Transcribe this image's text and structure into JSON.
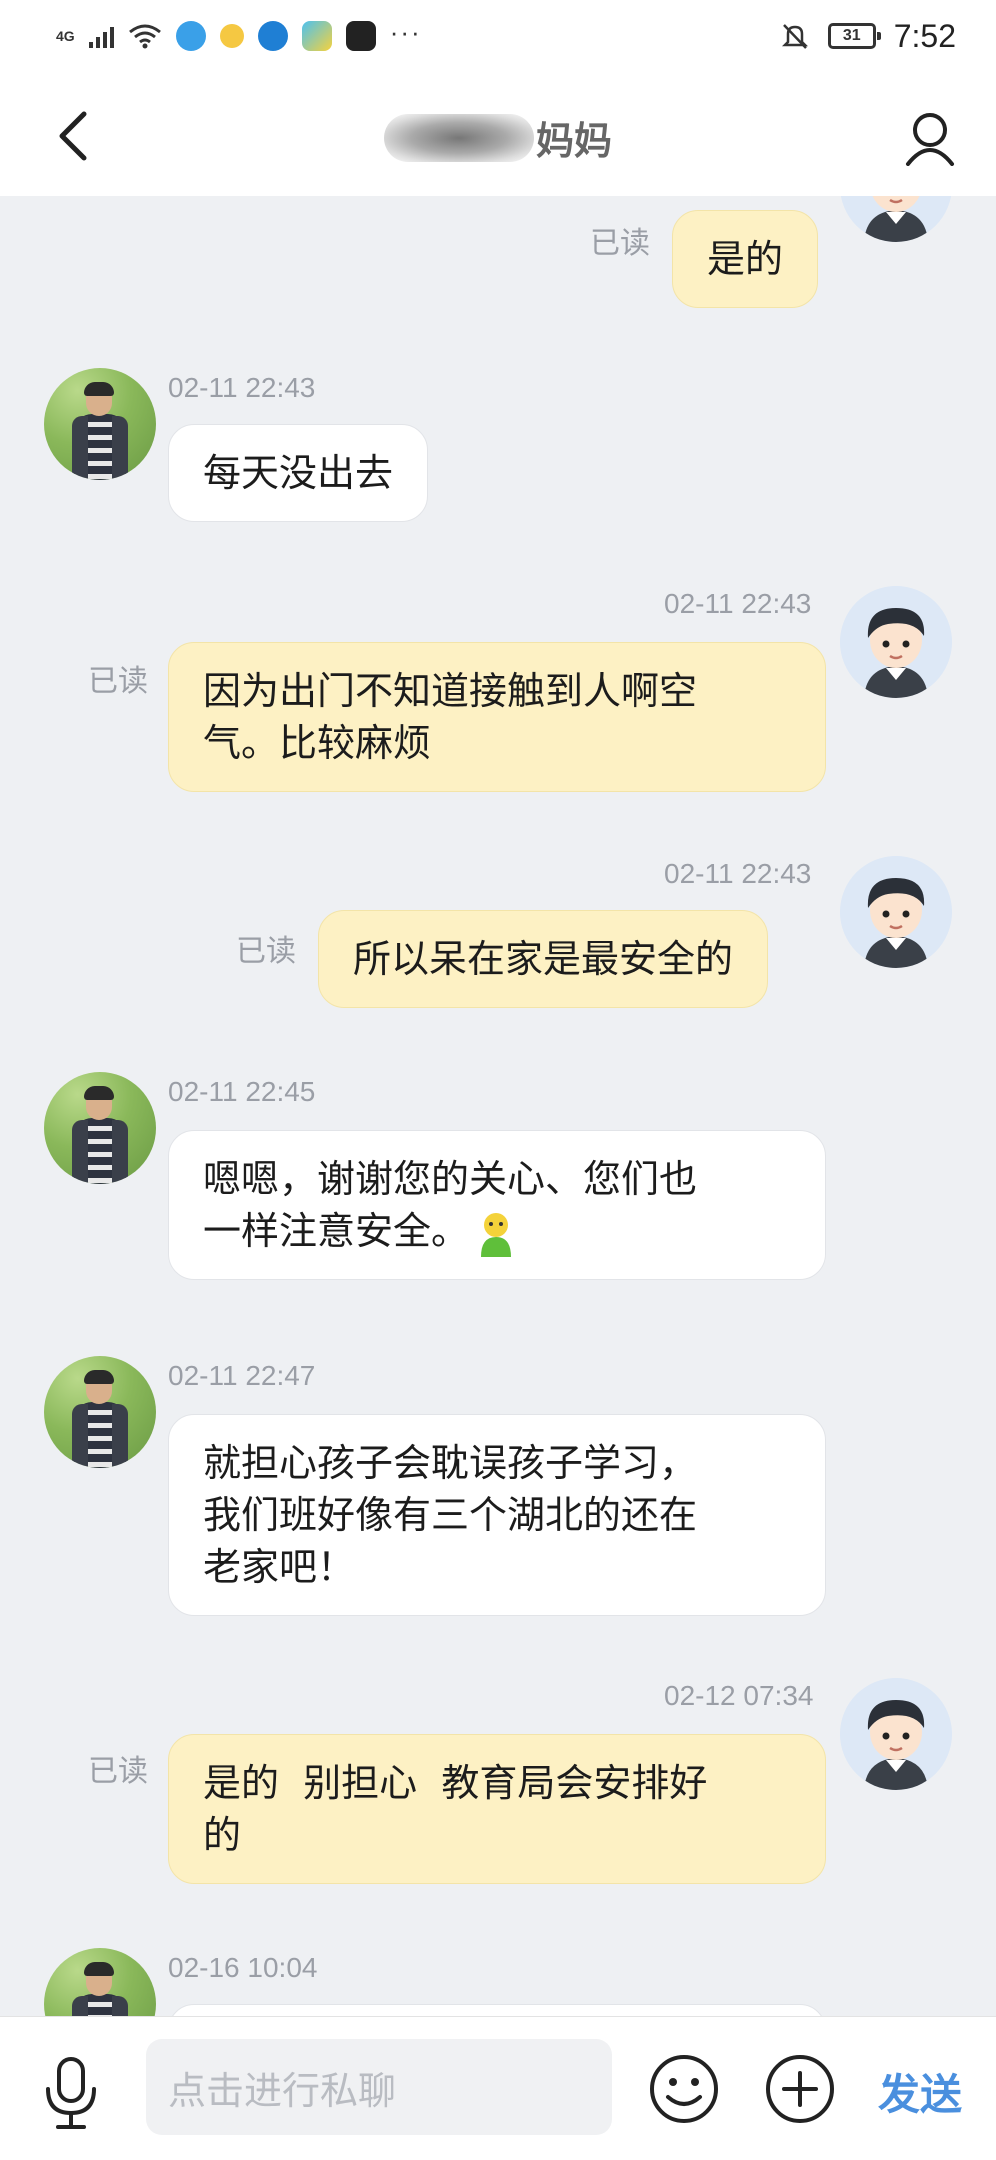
{
  "status_bar": {
    "network": "4G",
    "battery": "31",
    "time": "7:52",
    "more": "···"
  },
  "header": {
    "title_visible": "妈妈",
    "back_icon": "chevron-left-icon",
    "profile_icon": "person-icon"
  },
  "messages": [
    {
      "side": "out",
      "read": "已读",
      "lines": "是的"
    },
    {
      "side": "in",
      "time": "02-11 22:43",
      "lines": "每天没出去"
    },
    {
      "side": "out",
      "time": "02-11 22:43",
      "read": "已读",
      "line1": "因为出门不知道接触到人啊空",
      "line2": "气。比较麻烦"
    },
    {
      "side": "out",
      "time": "02-11 22:43",
      "read": "已读",
      "lines": "所以呆在家是最安全的"
    },
    {
      "side": "in",
      "time": "02-11 22:45",
      "line1": "嗯嗯，谢谢您的关心、您们也",
      "line2": "一样注意安全。",
      "emoji": "green-figure-emoji"
    },
    {
      "side": "in",
      "time": "02-11 22:47",
      "line1": "就担心孩子会耽误孩子学习，",
      "line2": "我们班好像有三个湖北的还在",
      "line3": "老家吧！"
    },
    {
      "side": "out",
      "time": "02-12 07:34",
      "read": "已读",
      "line1": "是的  别担心  教育局会安排好",
      "line2": "的"
    },
    {
      "side": "in",
      "time": "02-16 10:04"
    }
  ],
  "input_bar": {
    "placeholder": "点击进行私聊",
    "send_label": "发送",
    "colors": {
      "send": "#4a8fde",
      "outgoing_bubble": "#fdf1c4",
      "incoming_bubble": "#ffffff",
      "background": "#eef0f3"
    }
  }
}
